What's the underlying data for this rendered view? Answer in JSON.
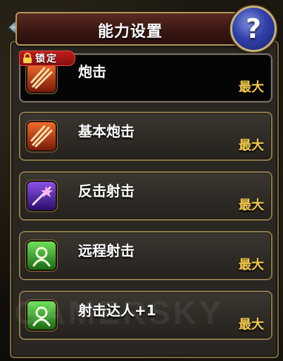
{
  "header": {
    "title": "能力设置"
  },
  "help": {
    "label": "?"
  },
  "lock_badge": {
    "label": "锁定"
  },
  "abilities": [
    {
      "name": "炮击",
      "level": "最大",
      "icon": "fire-claw-icon",
      "color": "#c8401c",
      "selected": true,
      "locked": true
    },
    {
      "name": "基本炮击",
      "level": "最大",
      "icon": "fire-claw-icon",
      "color": "#c8401c",
      "selected": false,
      "locked": false
    },
    {
      "name": "反击射击",
      "level": "最大",
      "icon": "purple-burst-icon",
      "color": "#6a2ec8",
      "selected": false,
      "locked": false
    },
    {
      "name": "远程射击",
      "level": "最大",
      "icon": "green-emblem-icon",
      "color": "#3ea82a",
      "selected": false,
      "locked": false
    },
    {
      "name": "射击达人+1",
      "level": "最大",
      "icon": "green-emblem-icon",
      "color": "#3ea82a",
      "selected": false,
      "locked": false
    }
  ],
  "watermark": {
    "text": "GAMERSKY"
  },
  "colors": {
    "level_text": "#f3c94a",
    "panel_border": "#8e7a4c",
    "lock_red": "#c01c1c"
  }
}
